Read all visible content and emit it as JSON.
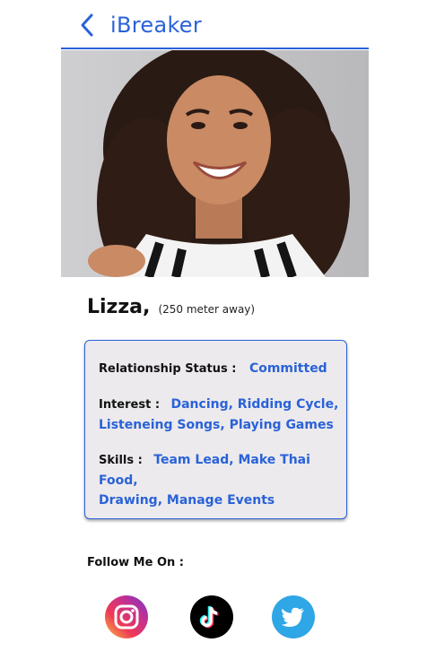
{
  "header": {
    "title": "iBreaker",
    "back_icon": "chevron-left-icon",
    "accent_color": "#2a62d8"
  },
  "profile": {
    "photo_icon": "profile-photo",
    "name": "Lizza,",
    "distance": "(250 meter away)"
  },
  "details": {
    "relationship_label": "Relationship Status :",
    "relationship_value": "Committed",
    "interest_label": "Interest :",
    "interest_value_line1": "Dancing, Ridding Cycle,",
    "interest_value_line2": "Listeneing Songs, Playing Games",
    "skills_label": "Skills :",
    "skills_value_line1": "Team Lead, Make Thai Food,",
    "skills_value_line2": "Drawing, Manage Events"
  },
  "social": {
    "label": "Follow Me On :",
    "links": [
      {
        "icon": "instagram-icon"
      },
      {
        "icon": "tiktok-icon"
      },
      {
        "icon": "twitter-icon"
      }
    ]
  }
}
